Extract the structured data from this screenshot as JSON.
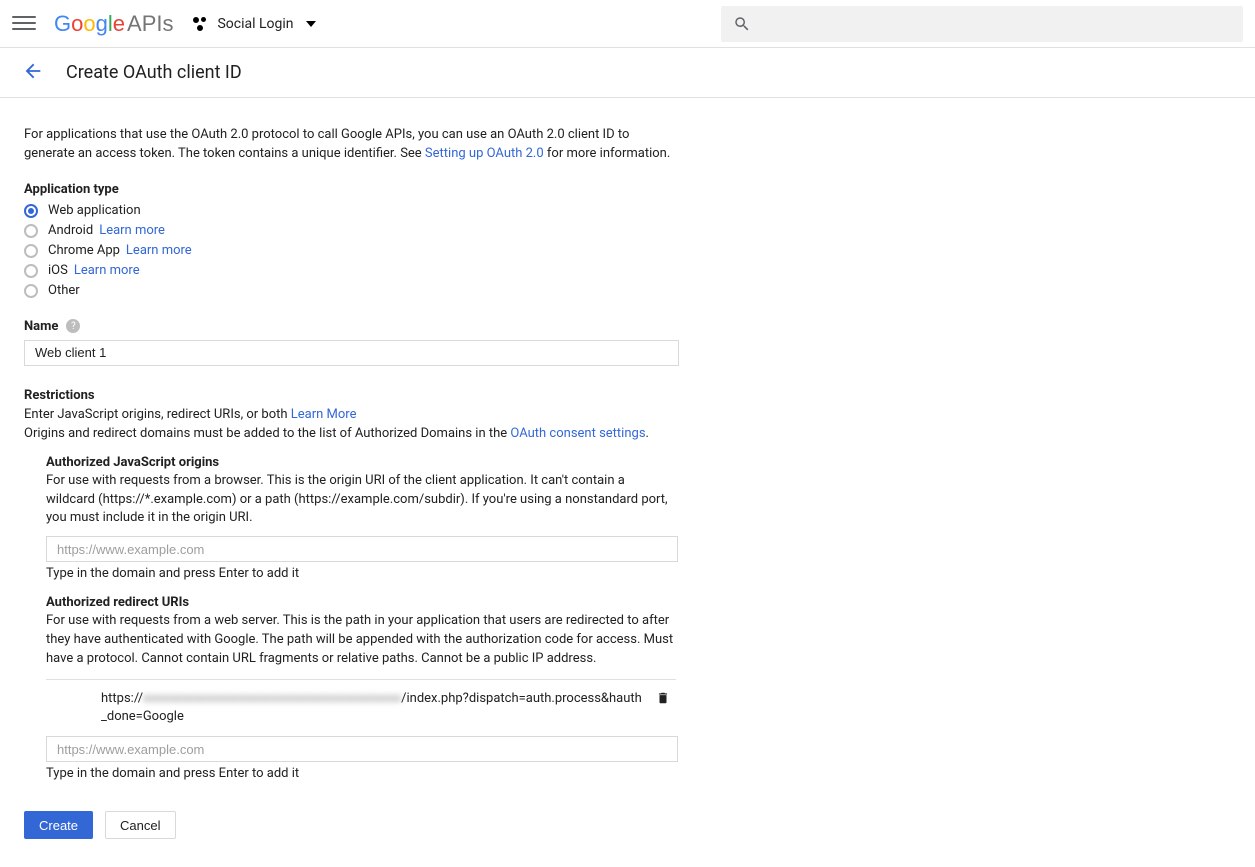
{
  "header": {
    "logo_apis": "APIs",
    "project_name": "Social Login"
  },
  "subheader": {
    "title": "Create OAuth client ID"
  },
  "intro": {
    "text1": "For applications that use the OAuth 2.0 protocol to call Google APIs, you can use an OAuth 2.0 client ID to generate an access token. The token contains a unique identifier. See ",
    "link": "Setting up OAuth 2.0",
    "text2": " for more information."
  },
  "app_type": {
    "label": "Application type",
    "options": [
      {
        "label": "Web application",
        "checked": true
      },
      {
        "label": "Android",
        "learn": "Learn more"
      },
      {
        "label": "Chrome App",
        "learn": "Learn more"
      },
      {
        "label": "iOS",
        "learn": "Learn more"
      },
      {
        "label": "Other"
      }
    ]
  },
  "name": {
    "label": "Name",
    "value": "Web client 1"
  },
  "restrictions": {
    "title": "Restrictions",
    "line1a": "Enter JavaScript origins, redirect URIs, or both ",
    "line1_link": "Learn More",
    "line2a": "Origins and redirect domains must be added to the list of Authorized Domains in the ",
    "line2_link": "OAuth consent settings",
    "line2b": "."
  },
  "js_origins": {
    "title": "Authorized JavaScript origins",
    "desc": "For use with requests from a browser. This is the origin URI of the client application. It can't contain a wildcard (https://*.example.com) or a path (https://example.com/subdir). If you're using a nonstandard port, you must include it in the origin URI.",
    "placeholder": "https://www.example.com",
    "hint": "Type in the domain and press Enter to add it"
  },
  "redirect_uris": {
    "title": "Authorized redirect URIs",
    "desc": "For use with requests from a web server. This is the path in your application that users are redirected to after they have authenticated with Google. The path will be appended with the authorization code for access. Must have a protocol. Cannot contain URL fragments or relative paths. Cannot be a public IP address.",
    "entries": [
      {
        "prefix": "https://",
        "blurred": "xxxxxxxxxxxxxxxxxxxxxxxxxxxxxxxxxxxxxxxx",
        "suffix": "/index.php?dispatch=auth.process&hauth_done=Google"
      }
    ],
    "placeholder": "https://www.example.com",
    "hint": "Type in the domain and press Enter to add it"
  },
  "buttons": {
    "create": "Create",
    "cancel": "Cancel"
  }
}
